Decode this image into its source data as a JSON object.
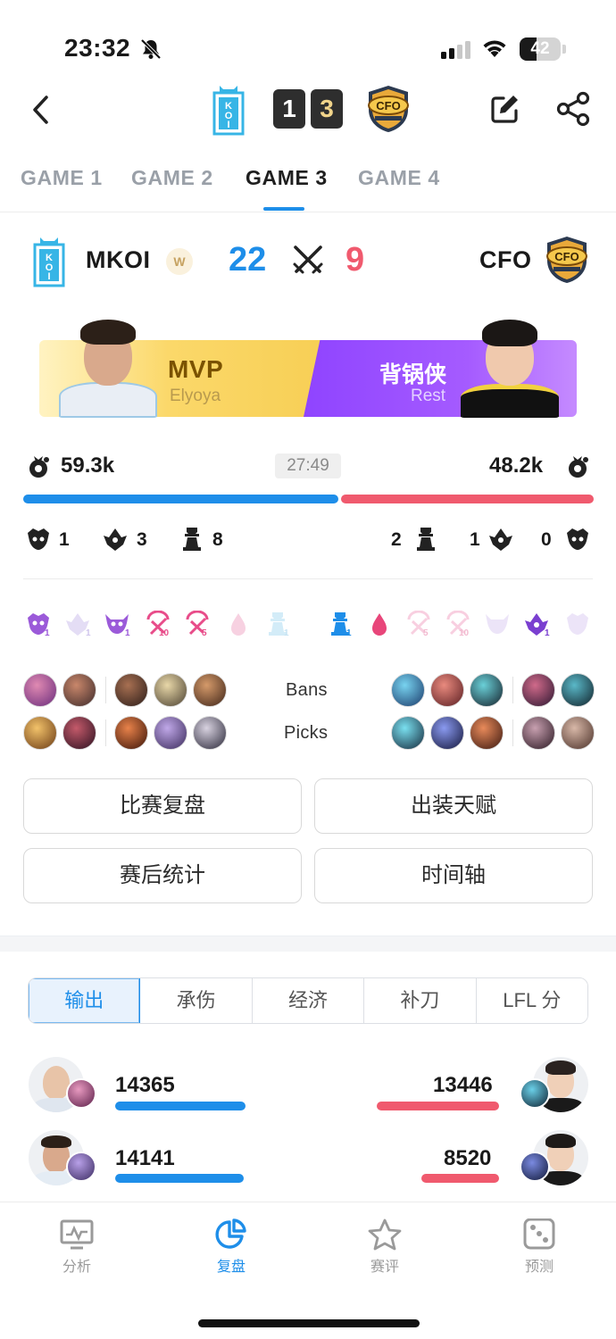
{
  "status_bar": {
    "time": "23:32",
    "battery": "42"
  },
  "header": {
    "score_left": "1",
    "score_right": "3"
  },
  "game_tabs": [
    "GAME 1",
    "GAME 2",
    "GAME 3",
    "GAME 4"
  ],
  "active_tab": "GAME 3",
  "teams": {
    "left": {
      "name": "MKOI",
      "badge": "W",
      "kills": "22",
      "gold": "59.3k",
      "color": "#1e8ee9"
    },
    "right": {
      "name": "CFO",
      "kills": "9",
      "gold": "48.2k",
      "color": "#f05a6e"
    }
  },
  "mvp": {
    "left_label": "MVP",
    "left_player": "Elyoya",
    "right_label": "背锅侠",
    "right_player": "Rest"
  },
  "game_time": "27:49",
  "gold_share_left": 0.552,
  "objectives": {
    "left": [
      {
        "icon": "grub-icon",
        "count": "1"
      },
      {
        "icon": "dragon-icon",
        "count": "3"
      },
      {
        "icon": "tower-icon",
        "count": "8"
      }
    ],
    "right": [
      {
        "icon": "tower-icon",
        "count": "2"
      },
      {
        "icon": "dragon-icon",
        "count": "1"
      },
      {
        "icon": "baron-icon",
        "count": "0"
      }
    ]
  },
  "timeline_subs": {
    "l1": "1",
    "l2": "1",
    "l3": "1",
    "l4": "10",
    "l5": "5",
    "l7": "1",
    "r1": "1",
    "r3": "5",
    "r4": "10",
    "r6": "1"
  },
  "labels": {
    "bans": "Bans",
    "picks": "Picks"
  },
  "buttons": [
    "比赛复盘",
    "出装天赋",
    "赛后统计",
    "时间轴"
  ],
  "stat_tabs": [
    "输出",
    "承伤",
    "经济",
    "补刀",
    "LFL 分"
  ],
  "damage_rows": [
    {
      "left": "14365",
      "right": "13446",
      "left_ratio": 1.0,
      "right_ratio": 0.936
    },
    {
      "left": "14141",
      "right": "8520",
      "left_ratio": 0.984,
      "right_ratio": 0.593
    }
  ],
  "bottom_nav": [
    "分析",
    "复盘",
    "赛评",
    "预测"
  ],
  "active_nav": "复盘"
}
